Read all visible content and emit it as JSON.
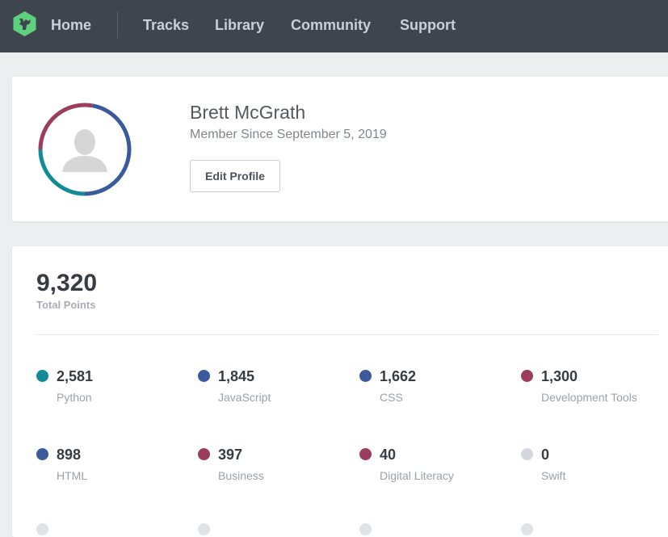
{
  "nav": {
    "logo_icon": "treehouse-logo-icon",
    "links": [
      {
        "label": "Home"
      },
      {
        "label": "Tracks"
      },
      {
        "label": "Library"
      },
      {
        "label": "Community"
      },
      {
        "label": "Support"
      }
    ]
  },
  "profile": {
    "avatar_icon": "user-silhouette-icon",
    "name": "Brett McGrath",
    "member_since": "Member Since September 5, 2019",
    "edit_button": "Edit Profile"
  },
  "stats": {
    "total_points": "9,320",
    "total_label": "Total Points",
    "skills": [
      {
        "points": "2,581",
        "label": "Python",
        "color": "#138a97"
      },
      {
        "points": "1,845",
        "label": "JavaScript",
        "color": "#3a5a9d"
      },
      {
        "points": "1,662",
        "label": "CSS",
        "color": "#3a5a9d"
      },
      {
        "points": "1,300",
        "label": "Development Tools",
        "color": "#9a3d5e"
      },
      {
        "points": "898",
        "label": "HTML",
        "color": "#3a5a9d"
      },
      {
        "points": "397",
        "label": "Business",
        "color": "#9a3d5e"
      },
      {
        "points": "40",
        "label": "Digital Literacy",
        "color": "#9a3d5e"
      },
      {
        "points": "0",
        "label": "Swift",
        "color": "#d4d8dc"
      }
    ]
  },
  "colors": {
    "nav_bg": "#3e454e",
    "logo_green": "#5fcf80",
    "ring_teal": "#138a97",
    "ring_blue": "#3a5a9d",
    "ring_maroon": "#9a3d5e"
  }
}
